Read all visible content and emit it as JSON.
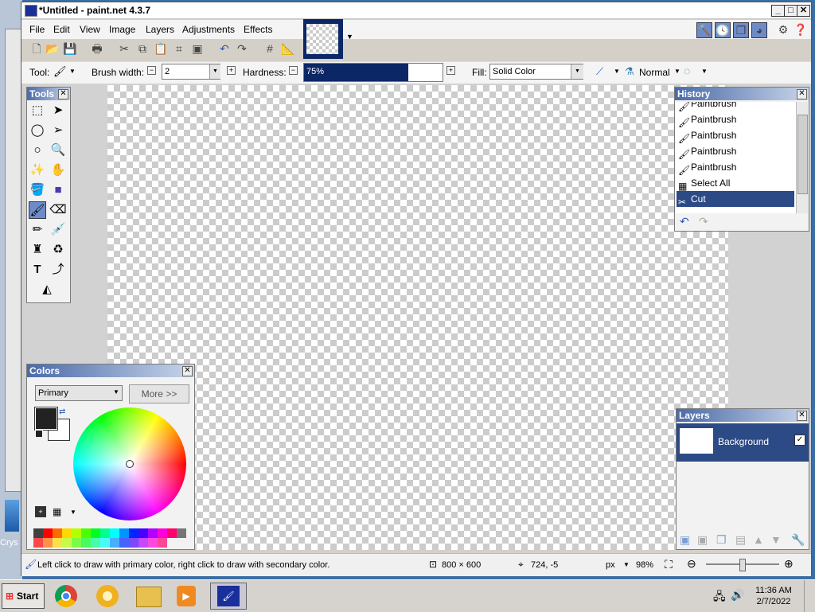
{
  "window": {
    "title": "*Untitled - paint.net 4.3.7",
    "min": "_",
    "max": "□",
    "close": "✕"
  },
  "menu": [
    "File",
    "Edit",
    "View",
    "Image",
    "Layers",
    "Adjustments",
    "Effects"
  ],
  "toolbar": {
    "tool_label": "Tool:",
    "brush_width_label": "Brush width:",
    "brush_width_value": "2",
    "hardness_label": "Hardness:",
    "hardness_value": "75%",
    "hardness_fraction": 0.75,
    "fill_label": "Fill:",
    "fill_value": "Solid Color",
    "blend_mode": "Normal"
  },
  "tools_panel": {
    "title": "Tools"
  },
  "history_panel": {
    "title": "History",
    "items": [
      {
        "label": "Paintbrush",
        "icon": "paintbrush-icon"
      },
      {
        "label": "Paintbrush",
        "icon": "paintbrush-icon"
      },
      {
        "label": "Paintbrush",
        "icon": "paintbrush-icon"
      },
      {
        "label": "Paintbrush",
        "icon": "paintbrush-icon"
      },
      {
        "label": "Paintbrush",
        "icon": "paintbrush-icon"
      },
      {
        "label": "Select All",
        "icon": "select-all-icon"
      },
      {
        "label": "Cut",
        "icon": "scissors-icon",
        "selected": true
      }
    ]
  },
  "colors_panel": {
    "title": "Colors",
    "mode": "Primary",
    "more_button": "More >>",
    "primary_color": "#222222",
    "secondary_color": "#ffffff",
    "palette": [
      "#404040",
      "#ff0000",
      "#ff6a00",
      "#ffd800",
      "#b6ff00",
      "#4cff00",
      "#00ff21",
      "#00ff90",
      "#00ffff",
      "#0094ff",
      "#0026ff",
      "#4800ff",
      "#b200ff",
      "#ff00dc",
      "#ff006e"
    ]
  },
  "layers_panel": {
    "title": "Layers",
    "layers": [
      {
        "name": "Background",
        "visible": true
      }
    ]
  },
  "status": {
    "hint": "Left click to draw with primary color, right click to draw with secondary color.",
    "image_size": "800 × 600",
    "cursor_pos": "724, -5",
    "units": "px",
    "zoom": "98%"
  },
  "taskbar": {
    "start": "Start",
    "time": "11:36 AM",
    "date": "2/7/2022"
  },
  "desktop": {
    "label": "Crys"
  },
  "colors": {
    "selection": "#0c2766",
    "title_gradient": "#4a6aa8",
    "layer_selected": "#2c4a86"
  }
}
